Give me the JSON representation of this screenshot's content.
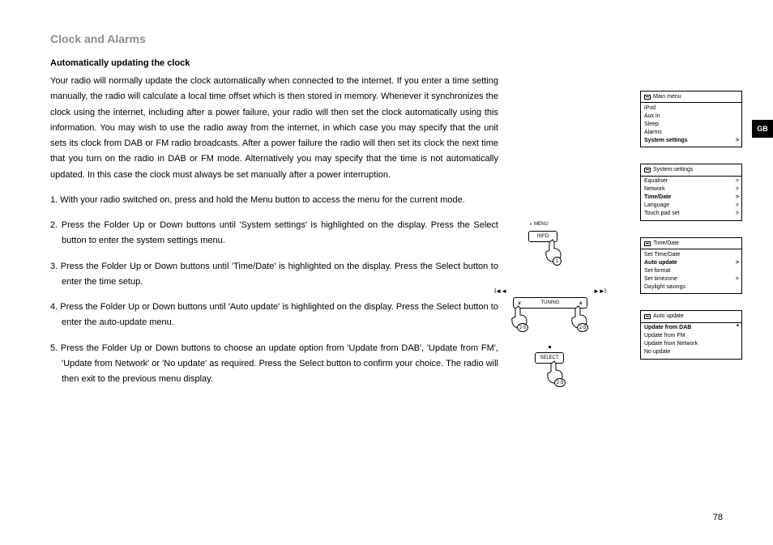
{
  "section_title": "Clock and Alarms",
  "subheading": "Automatically updating the clock",
  "intro": "Your radio will normally update the clock automatically when connected to the internet. If you enter a time setting manually, the radio will calculate a local time offset which is then stored in memory. Whenever it synchronizes the clock using the internet, including after a power failure, your radio will then set the clock automatically using this information. You may wish to use the radio away from the internet, in which case you may specify that the unit sets its clock from DAB or FM radio broadcasts. After a power failure the radio will then set its clock the next time that you turn on the radio in DAB or FM mode. Alternatively you may specify that the time is not automatically updated. In this case the clock must always be set manually after a power interruption.",
  "steps": [
    "With your radio switched on, press and hold the Menu button to access the menu for the current mode.",
    "Press the Folder Up or Down buttons until 'System settings' is highlighted on the display. Press the Select button to enter the system settings menu.",
    "Press the Folder Up or Down buttons until 'Time/Date' is highlighted on the display. Press the Select button to enter the time setup.",
    "Press the Folder Up or Down buttons until 'Auto update' is highlighted on the display. Press the Select button to enter the auto-update menu.",
    "Press the Folder Up or Down buttons to choose an update option from 'Update from DAB', 'Update from FM', 'Update from Network' or 'No update' as required. Press the Select button to confirm your choice. The radio will then exit to the previous menu display."
  ],
  "page_number": "78",
  "gb_label": "GB",
  "diagram": {
    "menu_label": "MENU",
    "info_label": "INFO",
    "tuning_label": "TUNING",
    "select_label": "SELECT",
    "step1": "1",
    "step25": "2-5"
  },
  "menus": {
    "main": {
      "title": "Main menu",
      "items": [
        {
          "label": "iPod"
        },
        {
          "label": "Aux in"
        },
        {
          "label": "Sleep"
        },
        {
          "label": "Alarms"
        },
        {
          "label": "System settings",
          "sel": true,
          "chev": true
        }
      ]
    },
    "system": {
      "title": "System settings",
      "items": [
        {
          "label": "Equaliser",
          "chev": true
        },
        {
          "label": "Network",
          "chev": true
        },
        {
          "label": "Time/Date",
          "sel": true,
          "chev": true
        },
        {
          "label": "Language",
          "chev": true
        },
        {
          "label": "Touch pad set",
          "chev": true
        }
      ]
    },
    "timedate": {
      "title": "Time/Date",
      "items": [
        {
          "label": "Set Time/Date"
        },
        {
          "label": "Auto update",
          "sel": true,
          "chev": true
        },
        {
          "label": "Set format"
        },
        {
          "label": "Set timezone",
          "chev": true
        },
        {
          "label": "Daylight savings"
        }
      ]
    },
    "auto": {
      "title": "Auto update",
      "items": [
        {
          "label": "Update from DAB",
          "sel": true,
          "star": true
        },
        {
          "label": "Update from FM"
        },
        {
          "label": "Update from Network"
        },
        {
          "label": "No update"
        }
      ]
    }
  }
}
